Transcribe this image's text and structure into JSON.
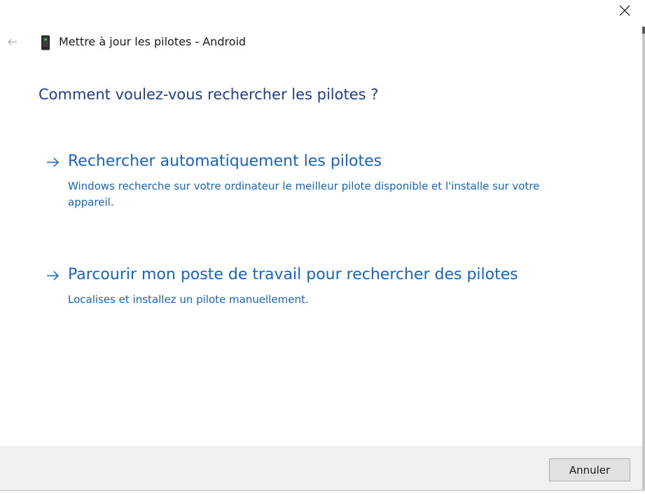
{
  "window": {
    "title": "Mettre à jour les pilotes - Android"
  },
  "icons": {
    "close": "close-icon",
    "back": "back-arrow-icon",
    "device": "phone-device-icon",
    "option_arrow": "arrow-right-icon"
  },
  "main": {
    "question": "Comment voulez-vous rechercher les pilotes ?",
    "options": [
      {
        "title": "Rechercher automatiquement les pilotes",
        "description": "Windows recherche sur votre ordinateur le meilleur pilote disponible et l'installe sur votre appareil."
      },
      {
        "title": "Parcourir mon poste de travail pour rechercher des pilotes",
        "description": "Localises et installez un pilote manuellement."
      }
    ]
  },
  "footer": {
    "cancel_label": "Annuler"
  },
  "colors": {
    "heading": "#1f3e8f",
    "link": "#1565c0",
    "footer_bg": "#f0f0f0",
    "button_bg": "#e1e1e1"
  }
}
